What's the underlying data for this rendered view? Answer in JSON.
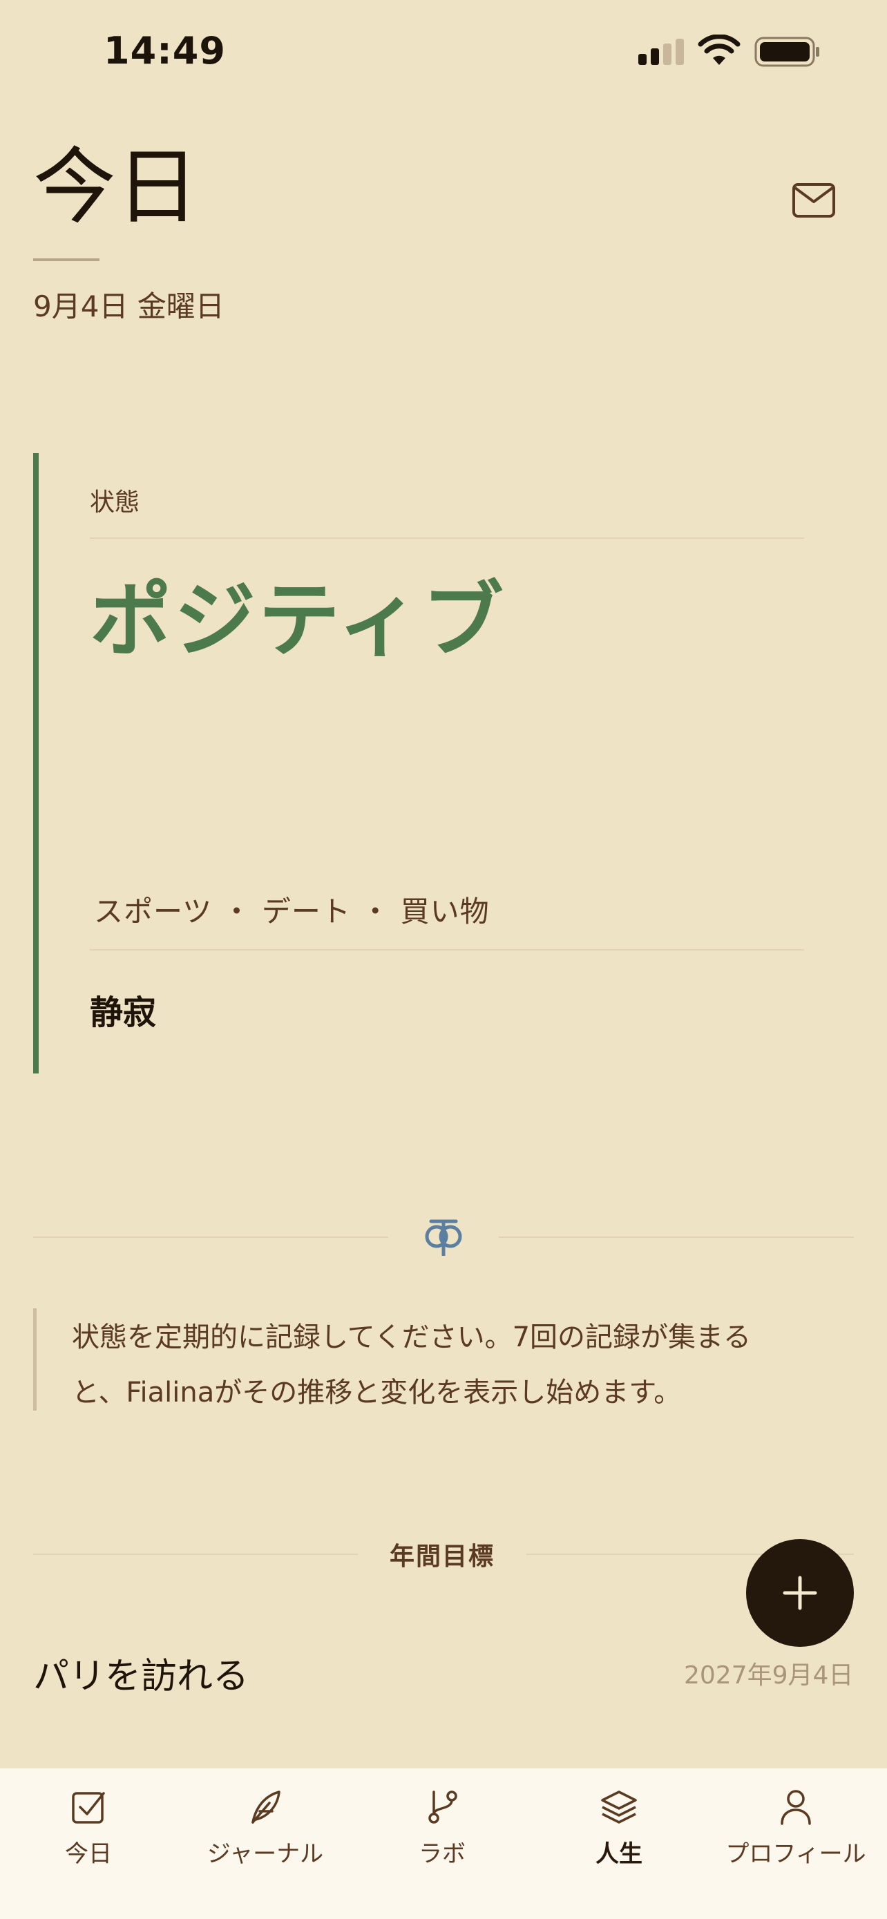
{
  "status_bar": {
    "time": "14:49"
  },
  "header": {
    "title": "今日",
    "date": "9月4日 金曜日"
  },
  "status_card": {
    "label": "状態",
    "status": "ポジティブ",
    "activities": "スポーツ ・ デート ・ 買い物",
    "mood": "静寂"
  },
  "info": {
    "text": "状態を定期的に記録してください。7回の記録が集まると、Fialinaがその推移と変化を表示し始めます。"
  },
  "goals": {
    "heading": "年間目標",
    "items": [
      {
        "title": "パリを訪れる",
        "date": "2027年9月4日"
      }
    ]
  },
  "tab_bar": {
    "items": [
      {
        "label": "今日",
        "icon": "checkbox-icon"
      },
      {
        "label": "ジャーナル",
        "icon": "feather-icon"
      },
      {
        "label": "ラボ",
        "icon": "branch-icon"
      },
      {
        "label": "人生",
        "icon": "layers-icon"
      },
      {
        "label": "プロフィール",
        "icon": "person-icon"
      }
    ]
  },
  "colors": {
    "background": "#efe3c5",
    "accent_green": "#4c7a4c",
    "text_brown": "#5a3a20",
    "fab": "#24170c",
    "tab_bar": "#fdf8ee"
  }
}
